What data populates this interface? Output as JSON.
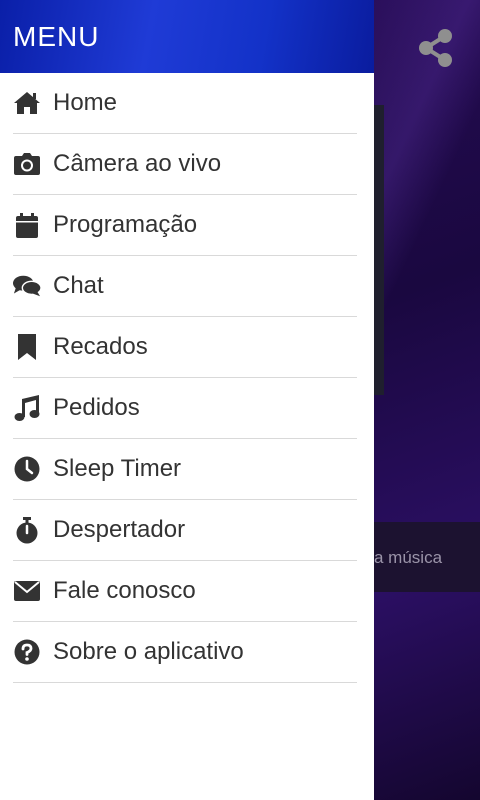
{
  "drawer": {
    "title": "MENU",
    "items": [
      {
        "label": "Home",
        "icon": "home-icon"
      },
      {
        "label": "Câmera ao vivo",
        "icon": "camera-icon"
      },
      {
        "label": "Programação",
        "icon": "calendar-icon"
      },
      {
        "label": "Chat",
        "icon": "chat-icon"
      },
      {
        "label": "Recados",
        "icon": "bookmark-icon"
      },
      {
        "label": "Pedidos",
        "icon": "music-icon"
      },
      {
        "label": "Sleep Timer",
        "icon": "clock-icon"
      },
      {
        "label": "Despertador",
        "icon": "stopwatch-icon"
      },
      {
        "label": "Fale conosco",
        "icon": "envelope-icon"
      },
      {
        "label": "Sobre o aplicativo",
        "icon": "question-icon"
      }
    ]
  },
  "background": {
    "song_fragment": "a música",
    "share_icon": "share-icon"
  },
  "colors": {
    "header": "#1f3bd6",
    "icon": "#333333",
    "background": "#1a0840"
  }
}
